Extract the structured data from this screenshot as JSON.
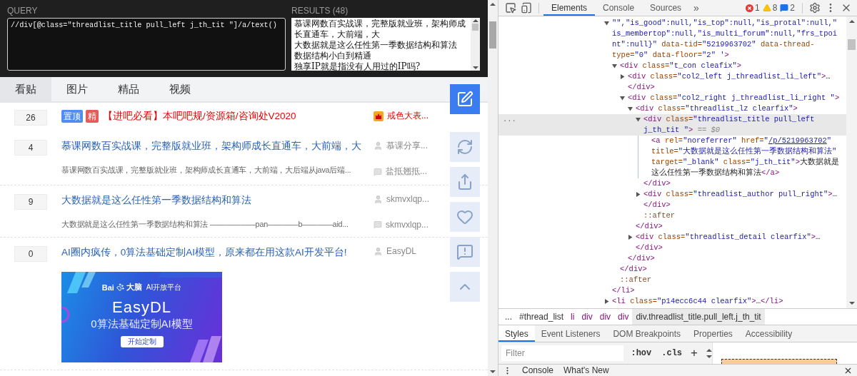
{
  "xpath_helper": {
    "query_label": "QUERY",
    "query": "//div[@class=\"threadlist_title pull_left j_th_tit \"]/a/text()",
    "results_label": "RESULTS (48)",
    "results": [
      "慕课网数百实战课，完整版就业班，架构师成长直通车，大前端，大",
      "大数据就是这么任性第一季数据结构和算法",
      "数据结构小白到精通",
      "独享IP就是指没有人用过的IP吗?"
    ]
  },
  "forum_tabs": [
    {
      "label": "看贴",
      "selected": true
    },
    {
      "label": "图片",
      "selected": false
    },
    {
      "label": "精品",
      "selected": false
    },
    {
      "label": "视频",
      "selected": false
    }
  ],
  "threads": [
    {
      "kind": "pinned",
      "replies": "26",
      "badges": [
        {
          "label": "置顶",
          "color": "#4d8ef0"
        },
        {
          "label": "精",
          "color": "#e85a5a"
        }
      ],
      "title": "【进吧必看】本吧吧规/资源箱/咨询处V2020",
      "author": "戒色大表..."
    },
    {
      "kind": "normal",
      "replies": "4",
      "title": "慕课网数百实战课，完整版就业班，架构师成长直通车，大前端，大",
      "author": "慕课分享...",
      "excerpt": "慕课网数百实战课，完整版就业班，架构师成长直通车，大前端，大后端从java后端...",
      "last_reply": "盐抵翘抵..."
    },
    {
      "kind": "normal",
      "replies": "9",
      "title": "大数据就是这么任性第一季数据结构和算法",
      "author": "skmvxlqp...",
      "excerpt": "大数据就是这么任性第一季数据结构和算法 ——————pan————b————aid...",
      "last_reply": "skmvxlqp..."
    },
    {
      "kind": "ad",
      "replies": "0",
      "title": "AI圈内疯传，0算法基础定制AI模型，原来都在用这款AI开发平台!",
      "author": "EasyDL",
      "banner": {
        "brand_prefix": "Bai",
        "brand_suffix": "大脑",
        "platform": "AI开放平台",
        "title": "EasyDL",
        "subtitle": "0算法基础定制AI模型",
        "button": "开始定制"
      }
    }
  ],
  "side_buttons": [
    {
      "kind": "post"
    },
    {
      "kind": "refresh"
    },
    {
      "kind": "share"
    },
    {
      "kind": "favorite"
    },
    {
      "kind": "report"
    },
    {
      "kind": "top"
    }
  ],
  "devtools": {
    "tabs": [
      {
        "label": "Elements",
        "selected": true
      },
      {
        "label": "Console",
        "selected": false
      },
      {
        "label": "Sources",
        "selected": false
      }
    ],
    "more": "»",
    "errors": "1",
    "warnings": "8",
    "messages": "2",
    "dom": [
      {
        "expanded": true,
        "tokens": [
          {
            "kind": "val",
            "text": "\"\",\"is_good\":null,\"is_top\":null,\"is_protal\":null,\"is_membertop\":null,\"is_multi_forum\":null,\"frs_tpoint\":null}\""
          },
          {
            "kind": "attr",
            "text": " data-tid="
          },
          {
            "kind": "val",
            "text": "\"5219963702\""
          },
          {
            "kind": "attr",
            "text": " data-thread-type="
          },
          {
            "kind": "val",
            "text": "\"0\""
          },
          {
            "kind": "attr",
            "text": " data-floor="
          },
          {
            "kind": "val",
            "text": "\"2\" '"
          },
          {
            "kind": "tag",
            "text": ">"
          }
        ],
        "close": [
          {
            "kind": "tag",
            "text": "</li>"
          }
        ],
        "children": [
          {
            "expanded": true,
            "tokens": [
              {
                "kind": "tag",
                "text": "<div"
              },
              {
                "kind": "attr",
                "text": " class="
              },
              {
                "kind": "val",
                "text": "\"t_con cleafix\""
              },
              {
                "kind": "tag",
                "text": ">"
              }
            ],
            "close": [
              {
                "kind": "tag",
                "text": "</div>"
              }
            ],
            "children": [
              {
                "expanded": false,
                "tokens": [
                  {
                    "kind": "tag",
                    "text": "<div"
                  },
                  {
                    "kind": "attr",
                    "text": " class="
                  },
                  {
                    "kind": "val",
                    "text": "\"col2_left j_threadlist_li_left\""
                  },
                  {
                    "kind": "tag",
                    "text": ">"
                  },
                  {
                    "kind": "text",
                    "text": "…"
                  },
                  {
                    "kind": "tag",
                    "text": "</div>"
                  }
                ]
              },
              {
                "expanded": true,
                "tokens": [
                  {
                    "kind": "tag",
                    "text": "<div"
                  },
                  {
                    "kind": "attr",
                    "text": " class="
                  },
                  {
                    "kind": "val",
                    "text": "\"col2_right j_threadlist_li_right \""
                  },
                  {
                    "kind": "tag",
                    "text": ">"
                  }
                ],
                "close": [
                  {
                    "kind": "tag",
                    "text": "</div>"
                  }
                ],
                "children": [
                  {
                    "expanded": true,
                    "tokens": [
                      {
                        "kind": "tag",
                        "text": "<div"
                      },
                      {
                        "kind": "attr",
                        "text": " class="
                      },
                      {
                        "kind": "val",
                        "text": "\"threadlist_lz clearfix\""
                      },
                      {
                        "kind": "tag",
                        "text": ">"
                      }
                    ],
                    "close": [
                      {
                        "kind": "tag",
                        "text": "</div>"
                      }
                    ],
                    "children": [
                      {
                        "expanded": true,
                        "selected": true,
                        "gutter": "...",
                        "tokens": [
                          {
                            "kind": "tag",
                            "text": "<div"
                          },
                          {
                            "kind": "attr",
                            "text": " class="
                          },
                          {
                            "kind": "val",
                            "text": "\"threadlist_title pull_left j_th_tit \""
                          },
                          {
                            "kind": "tag",
                            "text": ">"
                          },
                          {
                            "kind": "ref",
                            "text": " == $0"
                          }
                        ],
                        "close": [
                          {
                            "kind": "tag",
                            "text": "</div>"
                          }
                        ],
                        "children": [
                          {
                            "tokens": [
                              {
                                "kind": "tag",
                                "text": "<a"
                              },
                              {
                                "kind": "attr",
                                "text": " rel="
                              },
                              {
                                "kind": "val",
                                "text": "\"noreferrer\""
                              },
                              {
                                "kind": "attr",
                                "text": " href="
                              },
                              {
                                "kind": "val",
                                "text": "\""
                              },
                              {
                                "kind": "link",
                                "text": "/p/5219963702"
                              },
                              {
                                "kind": "val",
                                "text": "\""
                              },
                              {
                                "kind": "attr",
                                "text": " title="
                              },
                              {
                                "kind": "val",
                                "text": "\"大数据就是这么任性第一季数据结构和算法\""
                              },
                              {
                                "kind": "attr",
                                "text": " target="
                              },
                              {
                                "kind": "val",
                                "text": "\"_blank\""
                              },
                              {
                                "kind": "attr",
                                "text": " class="
                              },
                              {
                                "kind": "val",
                                "text": "\"j_th_tit\""
                              },
                              {
                                "kind": "tag",
                                "text": ">"
                              },
                              {
                                "kind": "text",
                                "text": "大数据就是这么任性第一季数据结构和算法"
                              },
                              {
                                "kind": "tag",
                                "text": "</a>"
                              }
                            ]
                          }
                        ]
                      },
                      {
                        "expanded": false,
                        "tokens": [
                          {
                            "kind": "tag",
                            "text": "<div"
                          },
                          {
                            "kind": "attr",
                            "text": " class="
                          },
                          {
                            "kind": "val",
                            "text": "\"threadlist_author pull_right\""
                          },
                          {
                            "kind": "tag",
                            "text": ">"
                          },
                          {
                            "kind": "text",
                            "text": "…"
                          },
                          {
                            "kind": "tag",
                            "text": "</div>"
                          }
                        ]
                      },
                      {
                        "tokens": [
                          {
                            "kind": "pseudo",
                            "text": "::after"
                          }
                        ]
                      }
                    ]
                  },
                  {
                    "expanded": false,
                    "tokens": [
                      {
                        "kind": "tag",
                        "text": "<div"
                      },
                      {
                        "kind": "attr",
                        "text": " class="
                      },
                      {
                        "kind": "val",
                        "text": "\"threadlist_detail clearfix\""
                      },
                      {
                        "kind": "tag",
                        "text": ">"
                      },
                      {
                        "kind": "text",
                        "text": "…"
                      },
                      {
                        "kind": "tag",
                        "text": "</div>"
                      }
                    ]
                  }
                ]
              }
            ]
          },
          {
            "tokens": [
              {
                "kind": "pseudo",
                "text": "::after"
              }
            ]
          }
        ]
      },
      {
        "expanded": false,
        "tokens": [
          {
            "kind": "tag",
            "text": "<li"
          },
          {
            "kind": "attr",
            "text": " class="
          },
          {
            "kind": "val",
            "text": "\"p14ecc6c44  clearfix\""
          },
          {
            "kind": "tag",
            "text": ">"
          },
          {
            "kind": "text",
            "text": "…"
          },
          {
            "kind": "tag",
            "text": "</li>"
          }
        ]
      }
    ],
    "breadcrumbs": [
      {
        "label": "...",
        "kind": "more",
        "selected": false
      },
      {
        "label": "#thread_list",
        "kind": "id",
        "selected": false
      },
      {
        "label": "li",
        "kind": "tag",
        "selected": false
      },
      {
        "label": "div",
        "kind": "tag",
        "selected": false
      },
      {
        "label": "div",
        "kind": "tag",
        "selected": false
      },
      {
        "label": "div",
        "kind": "tag",
        "selected": false
      },
      {
        "label": "div.threadlist_title.pull_left.j_th_tit",
        "kind": "id",
        "selected": true
      }
    ],
    "panel_tabs": [
      {
        "label": "Styles",
        "selected": true
      },
      {
        "label": "Event Listeners",
        "selected": false
      },
      {
        "label": "DOM Breakpoints",
        "selected": false
      },
      {
        "label": "Properties",
        "selected": false
      },
      {
        "label": "Accessibility",
        "selected": false
      }
    ],
    "filter": {
      "placeholder": "Filter"
    },
    "hov": ":hov",
    "cls": ".cls",
    "add": "+",
    "drawer_tabs": [
      {
        "label": "Console"
      },
      {
        "label": "What's New"
      }
    ]
  }
}
